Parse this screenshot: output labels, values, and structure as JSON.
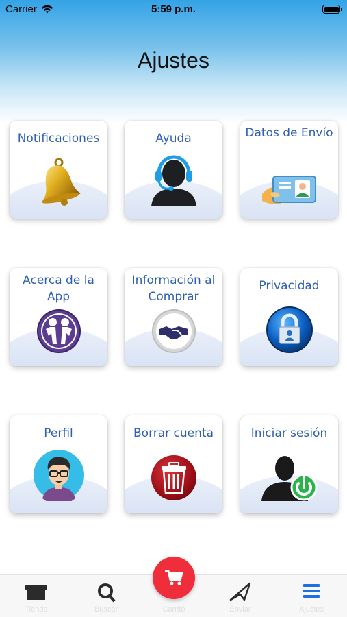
{
  "status_bar": {
    "carrier": "Carrier",
    "time": "5:59 p.m."
  },
  "page": {
    "title": "Ajustes"
  },
  "tiles": [
    {
      "label": "Notificaciones",
      "icon": "bell-icon"
    },
    {
      "label": "Ayuda",
      "icon": "support-agent-icon"
    },
    {
      "label": "Datos de Envío",
      "icon": "id-card-icon"
    },
    {
      "label": "Acerca de la App",
      "icon": "people-icon"
    },
    {
      "label": "Información al Comprar",
      "icon": "handshake-icon"
    },
    {
      "label": "Privacidad",
      "icon": "lock-icon"
    },
    {
      "label": "Perfil",
      "icon": "user-avatar-icon"
    },
    {
      "label": "Borrar cuenta",
      "icon": "trash-icon"
    },
    {
      "label": "Iniciar sesión",
      "icon": "login-power-icon"
    }
  ],
  "tabbar": {
    "tabs": [
      {
        "label": "Tienda",
        "icon": "store-icon"
      },
      {
        "label": "Buscar",
        "icon": "search-icon"
      },
      {
        "label": "Carrito",
        "icon": "cart-icon"
      },
      {
        "label": "Enviar",
        "icon": "send-icon"
      },
      {
        "label": "Ajustes",
        "icon": "menu-icon"
      }
    ],
    "fab_icon": "cart-icon"
  },
  "colors": {
    "accent": "#2f5fb4",
    "header_gradient_top": "#33a3e6",
    "fab": "#f02d3a",
    "active_tab": "#1f6fe0"
  }
}
